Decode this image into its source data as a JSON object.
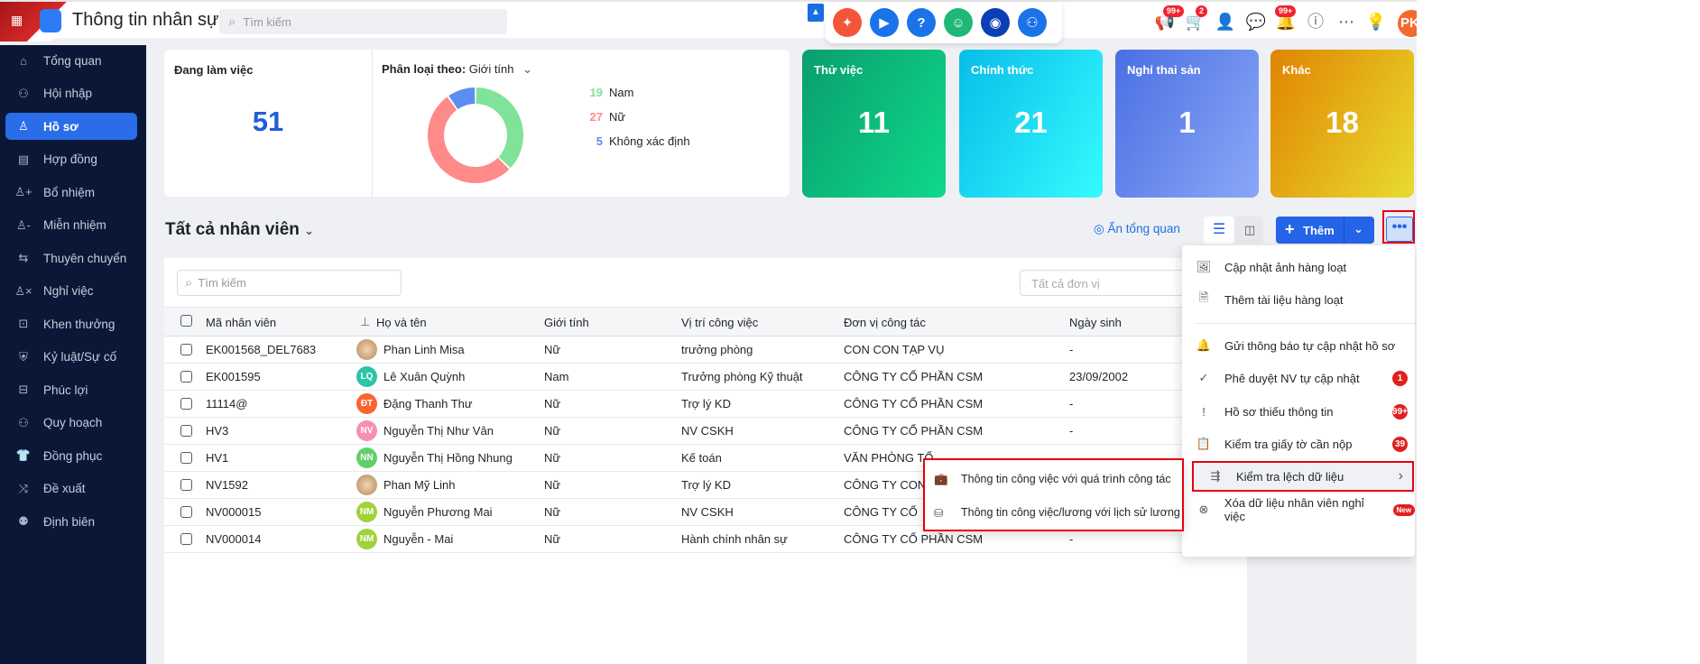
{
  "header": {
    "title": "Thông tin nhân sự",
    "search_placeholder": "Tìm kiếm",
    "badges": {
      "announce": "99+",
      "cart": "2",
      "bell": "99+"
    },
    "avatar": "PK"
  },
  "sidebar": {
    "items": [
      {
        "label": "Tổng quan",
        "icon": "home"
      },
      {
        "label": "Hội nhập",
        "icon": "users"
      },
      {
        "label": "Hồ sơ",
        "icon": "user"
      },
      {
        "label": "Hợp đồng",
        "icon": "file"
      },
      {
        "label": "Bổ nhiệm",
        "icon": "user-plus"
      },
      {
        "label": "Miễn nhiệm",
        "icon": "user-minus"
      },
      {
        "label": "Thuyên chuyển",
        "icon": "swap"
      },
      {
        "label": "Nghỉ việc",
        "icon": "user-x"
      },
      {
        "label": "Khen thưởng",
        "icon": "ticket"
      },
      {
        "label": "Kỷ luật/Sự cố",
        "icon": "shield"
      },
      {
        "label": "Phúc lợi",
        "icon": "gift"
      },
      {
        "label": "Quy hoạch",
        "icon": "group"
      },
      {
        "label": "Đồng phục",
        "icon": "shirt"
      },
      {
        "label": "Đề xuất",
        "icon": "flow"
      },
      {
        "label": "Định biên",
        "icon": "org"
      }
    ]
  },
  "overview": {
    "working_label": "Đang làm việc",
    "working_value": "51",
    "classify_label": "Phân loại theo:",
    "classify_value": "Giới tính",
    "gender": [
      {
        "value": "19",
        "label": "Nam",
        "color": "#7fe39a"
      },
      {
        "value": "27",
        "label": "Nữ",
        "color": "#ff8a8a"
      },
      {
        "value": "5",
        "label": "Không xác định",
        "color": "#5b8ef0"
      }
    ],
    "stats": [
      {
        "label": "Thử việc",
        "value": "11"
      },
      {
        "label": "Chính thức",
        "value": "21"
      },
      {
        "label": "Nghỉ thai sản",
        "value": "1"
      },
      {
        "label": "Khác",
        "value": "18"
      }
    ]
  },
  "list": {
    "title": "Tất cả nhân viên",
    "hide_overview": "Ẩn tổng quan",
    "add": "Thêm",
    "search_placeholder": "Tìm kiếm",
    "unit_placeholder": "Tất cả đơn vị",
    "columns": [
      "Mã nhân viên",
      "Họ và tên",
      "Giới tính",
      "Vị trí công việc",
      "Đơn vị công tác",
      "Ngày sinh"
    ],
    "rows": [
      {
        "code": "EK001568_DEL7683",
        "initials": "",
        "name": "Phan Linh Misa",
        "gender": "Nữ",
        "position": "trưởng phòng",
        "unit": "CON CON TẠP VỤ",
        "dob": "-"
      },
      {
        "code": "EK001595",
        "initials": "LQ",
        "name": "Lê Xuân Quỳnh",
        "gender": "Nam",
        "position": "Trưởng phòng Kỹ thuật",
        "unit": "CÔNG TY CỔ PHẦN CSM",
        "dob": "23/09/2002"
      },
      {
        "code": "11114@",
        "initials": "ĐT",
        "name": "Đặng Thanh Thư",
        "gender": "Nữ",
        "position": "Trợ lý KD",
        "unit": "CÔNG TY CỔ PHẦN CSM",
        "dob": "-"
      },
      {
        "code": "HV3",
        "initials": "NV",
        "name": "Nguyễn Thị Như Vân",
        "gender": "Nữ",
        "position": "NV CSKH",
        "unit": "CÔNG TY CỔ PHẦN CSM",
        "dob": "-"
      },
      {
        "code": "HV1",
        "initials": "NN",
        "name": "Nguyễn Thị Hồng Nhung",
        "gender": "Nữ",
        "position": "Kế toán",
        "unit": "VĂN PHÒNG TỔ",
        "dob": ""
      },
      {
        "code": "NV1592",
        "initials": "",
        "name": "Phan Mỹ Linh",
        "gender": "Nữ",
        "position": "Trợ lý KD",
        "unit": "CÔNG TY CON",
        "dob": ""
      },
      {
        "code": "NV000015",
        "initials": "NM",
        "name": "Nguyễn Phương Mai",
        "gender": "Nữ",
        "position": "NV CSKH",
        "unit": "CÔNG TY CỔ",
        "dob": ""
      },
      {
        "code": "NV000014",
        "initials": "NM",
        "name": "Nguyễn - Mai",
        "gender": "Nữ",
        "position": "Hành chính nhân sự",
        "unit": "CÔNG TY CỔ PHẦN CSM",
        "dob": "-"
      }
    ]
  },
  "menu": {
    "items": [
      {
        "label": "Cập nhật ảnh hàng loạt",
        "badge": ""
      },
      {
        "label": "Thêm tài liệu hàng loạt",
        "badge": ""
      },
      {
        "label": "Gửi thông báo tự cập nhật hồ sơ",
        "badge": ""
      },
      {
        "label": "Phê duyệt NV tự cập nhật",
        "badge": "1"
      },
      {
        "label": "Hồ sơ thiếu thông tin",
        "badge": "99+"
      },
      {
        "label": "Kiểm tra giấy tờ cần nộp",
        "badge": "39"
      },
      {
        "label": "Kiểm tra lệch dữ liệu",
        "badge": ""
      },
      {
        "label": "Xóa dữ liệu nhân viên nghỉ việc",
        "badge": "New"
      }
    ]
  },
  "submenu": {
    "items": [
      "Thông tin công việc với quá trình công tác",
      "Thông tin công việc/lương với lịch sử lương"
    ]
  }
}
